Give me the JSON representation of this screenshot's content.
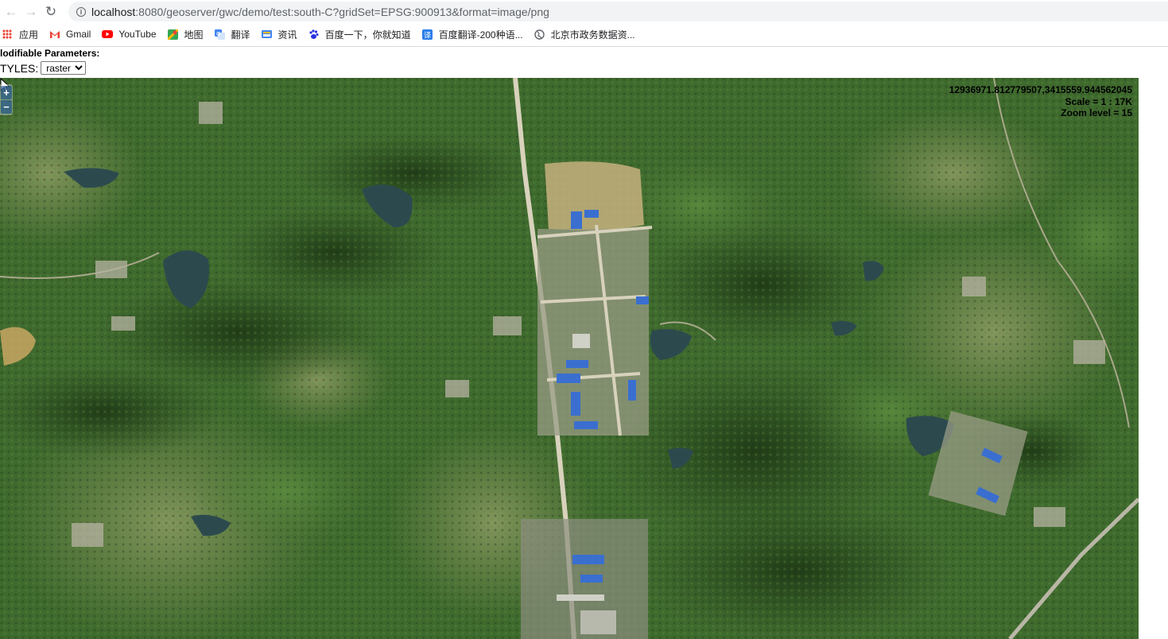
{
  "browser": {
    "url_host": "localhost",
    "url_rest": ":8080/geoserver/gwc/demo/test:south-C?gridSet=EPSG:900913&format=image/png"
  },
  "bookmarks": [
    {
      "label": "应用",
      "icon": "apps-grid-icon"
    },
    {
      "label": "Gmail",
      "icon": "gmail-icon",
      "color": "#ea4335"
    },
    {
      "label": "YouTube",
      "icon": "youtube-icon",
      "color": "#ff0000"
    },
    {
      "label": "地图",
      "icon": "maps-icon",
      "color": "#34a853"
    },
    {
      "label": "翻译",
      "icon": "translate-icon",
      "color": "#4285f4"
    },
    {
      "label": "资讯",
      "icon": "news-icon",
      "color": "#4285f4"
    },
    {
      "label": "百度一下，你就知道",
      "icon": "baidu-paw-icon",
      "color": "#2932e1"
    },
    {
      "label": "百度翻译-200种语...",
      "icon": "baidu-translate-icon",
      "color": "#2b7de9"
    },
    {
      "label": "北京市政务数据资...",
      "icon": "globe-icon",
      "color": "#5f6368"
    }
  ],
  "page": {
    "modifiable_label": "lodifiable Parameters:",
    "styles_label": "TYLES:",
    "styles_selected": "raster"
  },
  "map": {
    "coordinates": "12936971.812779507,3415559.944562045",
    "scale": "Scale = 1 : 17K",
    "zoom_level": "Zoom level = 15",
    "zoom_in": "+",
    "zoom_out": "−"
  },
  "colors": {
    "forest_dark": "#2a4a1e",
    "forest": "#3f6a2e",
    "field": "#7a8a52",
    "water": "#2c4a4e",
    "road": "#d8d2bc",
    "roof_blue": "#3a6fd0"
  }
}
